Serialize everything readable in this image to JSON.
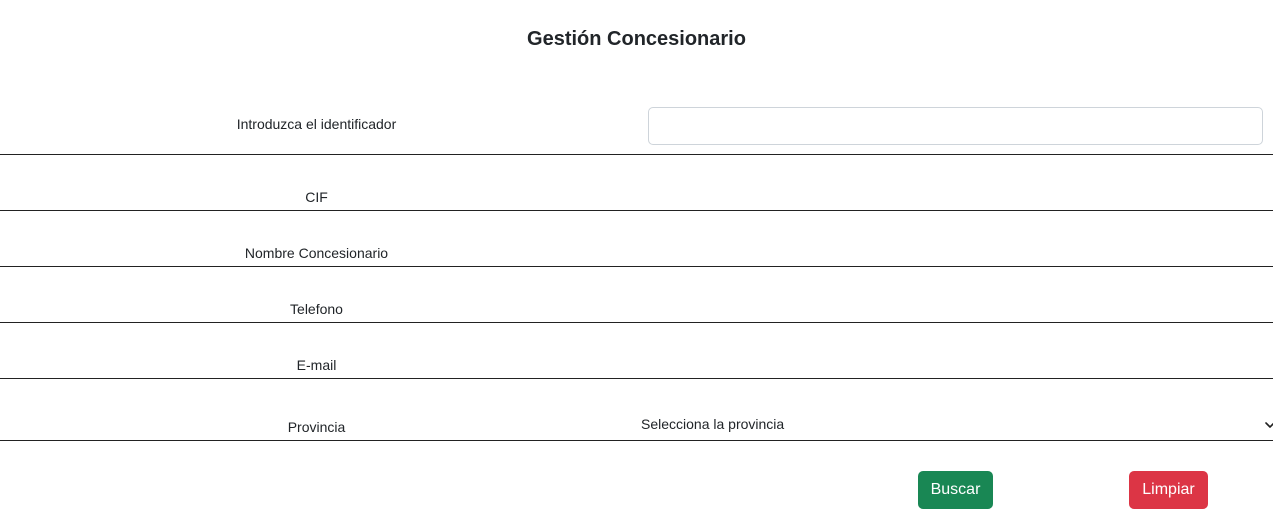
{
  "page": {
    "title": "Gestión Concesionario"
  },
  "form": {
    "id_label": "Introduzca el identificador",
    "id_value": "",
    "cif_label": "CIF",
    "nombre_label": "Nombre Concesionario",
    "telefono_label": "Telefono",
    "email_label": "E-mail",
    "provincia_label": "Provincia",
    "provincia_selected": "Selecciona la provincia"
  },
  "actions": {
    "buscar_label": "Buscar",
    "limpiar_label": "Limpiar"
  },
  "colors": {
    "buscar_bg": "#198754",
    "limpiar_bg": "#dc3545",
    "text": "#212529",
    "row_border": "#222222"
  },
  "icons": {
    "provincia_dropdown": "chevron-down-icon"
  }
}
